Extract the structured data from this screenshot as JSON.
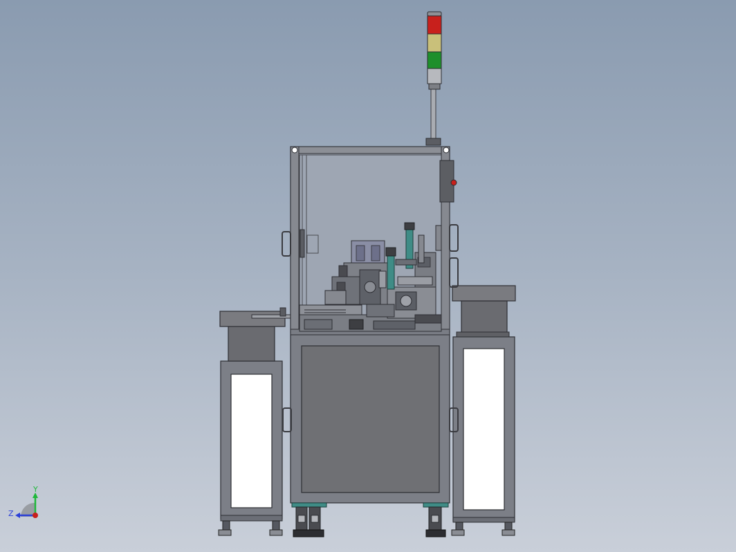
{
  "viewport": {
    "background_top": "#8a9bb0",
    "background_bottom": "#c9cfd9"
  },
  "model": {
    "frame_color": "#7c7f87",
    "panel_color": "#6f7074",
    "glass_color": "#9ea6b3",
    "dark_color": "#4a4b4f",
    "teal_color": "#3f8c86"
  },
  "signal_tower": {
    "lamps": [
      {
        "color": "red",
        "hex": "#c8201c"
      },
      {
        "color": "yellow",
        "hex": "#c9c07a"
      },
      {
        "color": "green",
        "hex": "#1e8f2b"
      }
    ]
  },
  "triad": {
    "y_label": "Y",
    "z_label": "Z",
    "y_color": "#1fb83a",
    "z_color": "#2a3fd8",
    "origin_color": "#c8201c"
  }
}
